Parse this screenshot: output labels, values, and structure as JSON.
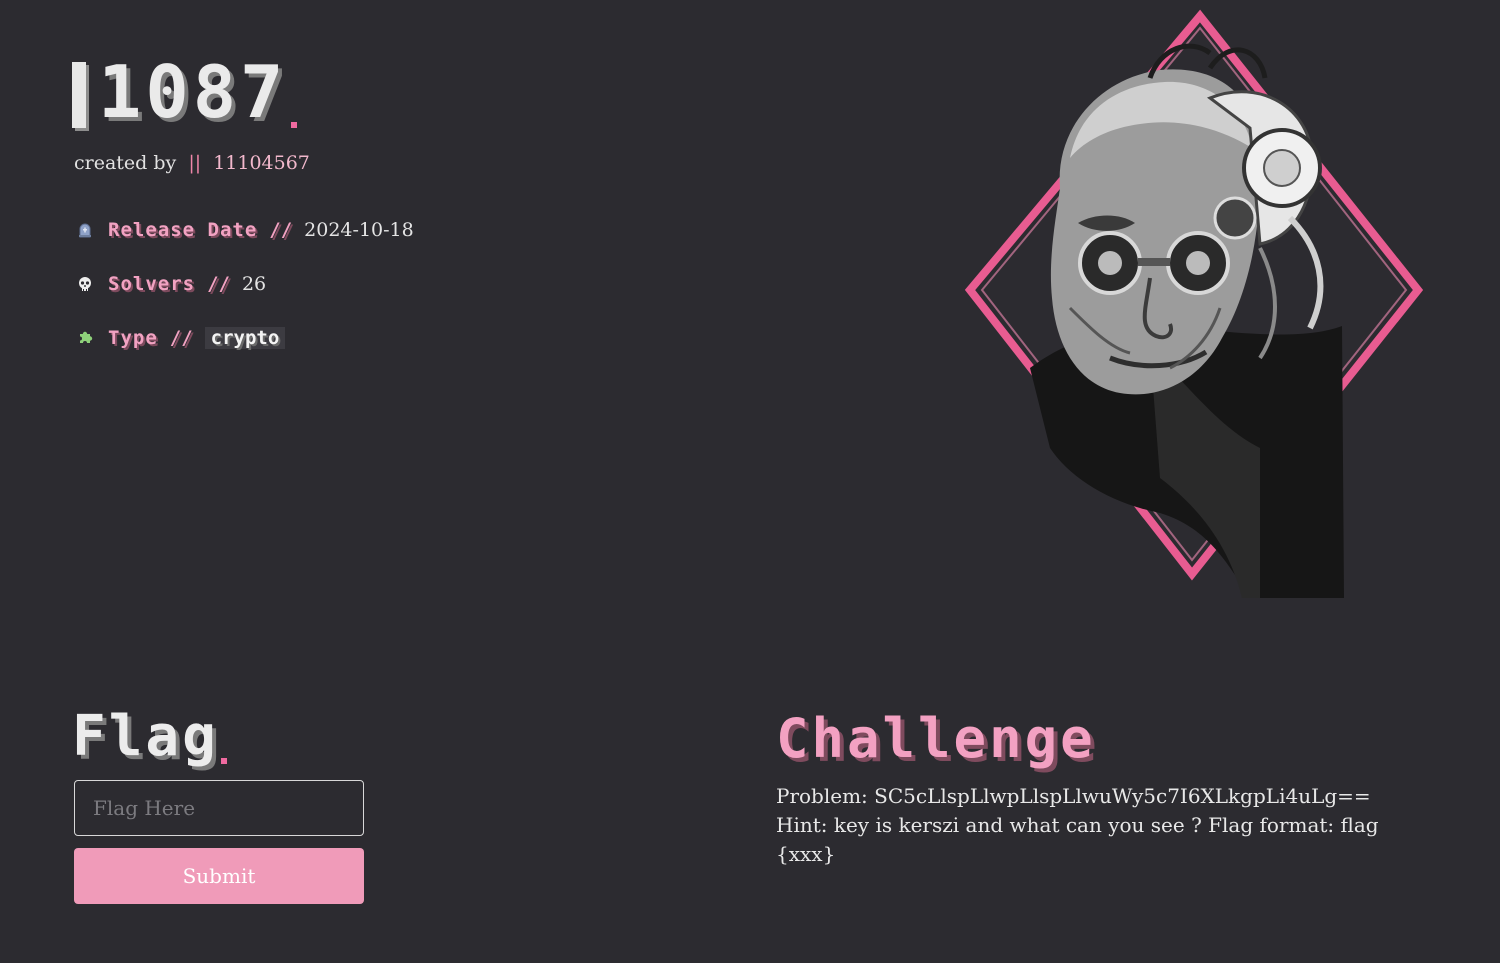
{
  "challenge": {
    "id": "1087",
    "created_by_label": "created by",
    "separator": "||",
    "author": "11104567"
  },
  "meta": {
    "release_label": "Release Date",
    "release_value": "2024-10-18",
    "solvers_label": "Solvers",
    "solvers_value": "26",
    "type_label": "Type",
    "type_value": "crypto",
    "slash": "//"
  },
  "icons": {
    "release": "tombstone-icon",
    "solvers": "skull-icon",
    "type": "puzzle-icon"
  },
  "flag_section": {
    "title": "Flag",
    "input_placeholder": "Flag Here",
    "submit_label": "Submit"
  },
  "challenge_section": {
    "title": "Challenge",
    "problem": "Problem: SC5cLlspLlwpLlspLlwuWy5c7I6XLkgpLi4uLg==",
    "hint": "Hint: key is kerszi and what can you see ? Flag format: flag{xxx}"
  },
  "colors": {
    "background": "#2c2b30",
    "accent_pink": "#f09bb9",
    "text": "#e6e6e6"
  }
}
